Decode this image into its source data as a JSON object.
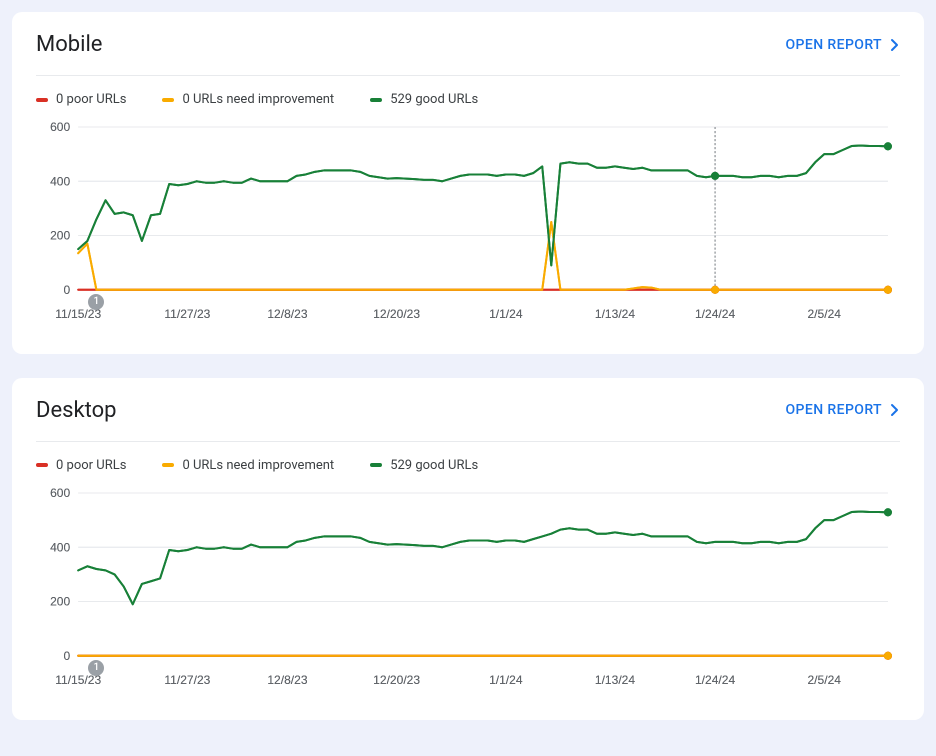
{
  "open_report_label": "OPEN REPORT",
  "event_marker_label": "1",
  "colors": {
    "poor": "#d93025",
    "needs": "#f9ab00",
    "good": "#188038",
    "grid": "#e8eaed",
    "axis_text": "#5f6368",
    "hover_line": "#80868b"
  },
  "mobile": {
    "title": "Mobile",
    "legend": {
      "poor": "0 poor URLs",
      "needs": "0 URLs need improvement",
      "good": "529 good URLs"
    },
    "hover_date_idx": 70
  },
  "desktop": {
    "title": "Desktop",
    "legend": {
      "poor": "0 poor URLs",
      "needs": "0 URLs need improvement",
      "good": "529 good URLs"
    }
  },
  "chart_data": [
    {
      "id": "mobile",
      "type": "line",
      "title": "Mobile",
      "xlabel": "",
      "ylabel": "",
      "ylim": [
        0,
        600
      ],
      "y_ticks": [
        0,
        200,
        400,
        600
      ],
      "x_tick_labels": [
        "11/15/23",
        "11/27/23",
        "12/8/23",
        "12/20/23",
        "1/1/24",
        "1/13/24",
        "1/24/24",
        "2/5/24"
      ],
      "x_tick_idx": [
        0,
        12,
        23,
        35,
        47,
        59,
        70,
        82
      ],
      "n_points": 90,
      "event_marker_idx": 2,
      "hover_idx": 70,
      "series": [
        {
          "name": "0 poor URLs",
          "color": "#d93025",
          "values": [
            0,
            0,
            0,
            0,
            0,
            0,
            0,
            0,
            0,
            0,
            0,
            0,
            0,
            0,
            0,
            0,
            0,
            0,
            0,
            0,
            0,
            0,
            0,
            0,
            0,
            0,
            0,
            0,
            0,
            0,
            0,
            0,
            0,
            0,
            0,
            0,
            0,
            0,
            0,
            0,
            0,
            0,
            0,
            0,
            0,
            0,
            0,
            0,
            0,
            0,
            0,
            0,
            0,
            0,
            0,
            0,
            0,
            0,
            0,
            0,
            0,
            0,
            0,
            0,
            0,
            0,
            0,
            0,
            0,
            0,
            0,
            0,
            0,
            0,
            0,
            0,
            0,
            0,
            0,
            0,
            0,
            0,
            0,
            0,
            0,
            0,
            0,
            0,
            0,
            0
          ]
        },
        {
          "name": "0 URLs need improvement",
          "color": "#f9ab00",
          "values": [
            135,
            170,
            0,
            0,
            0,
            0,
            0,
            0,
            0,
            0,
            0,
            0,
            0,
            0,
            0,
            0,
            0,
            0,
            0,
            0,
            0,
            0,
            0,
            0,
            0,
            0,
            0,
            0,
            0,
            0,
            0,
            0,
            0,
            0,
            0,
            0,
            0,
            0,
            0,
            0,
            0,
            0,
            0,
            0,
            0,
            0,
            0,
            0,
            0,
            0,
            0,
            0,
            250,
            0,
            0,
            0,
            0,
            0,
            0,
            0,
            0,
            5,
            10,
            8,
            0,
            0,
            0,
            0,
            0,
            0,
            0,
            0,
            0,
            0,
            0,
            0,
            0,
            0,
            0,
            0,
            0,
            0,
            0,
            0,
            0,
            0,
            0,
            0,
            0,
            0
          ]
        },
        {
          "name": "529 good URLs",
          "color": "#188038",
          "values": [
            150,
            180,
            260,
            330,
            280,
            285,
            275,
            180,
            275,
            280,
            390,
            385,
            390,
            400,
            395,
            395,
            400,
            395,
            395,
            410,
            400,
            400,
            400,
            400,
            420,
            425,
            435,
            440,
            440,
            440,
            440,
            435,
            420,
            415,
            410,
            412,
            410,
            408,
            405,
            405,
            400,
            410,
            420,
            425,
            425,
            425,
            420,
            425,
            425,
            420,
            430,
            455,
            90,
            465,
            470,
            465,
            465,
            450,
            450,
            455,
            450,
            445,
            450,
            440,
            440,
            440,
            440,
            440,
            420,
            415,
            420,
            420,
            420,
            415,
            415,
            420,
            420,
            415,
            420,
            420,
            430,
            470,
            500,
            500,
            515,
            530,
            532,
            530,
            530,
            529
          ]
        }
      ]
    },
    {
      "id": "desktop",
      "type": "line",
      "title": "Desktop",
      "xlabel": "",
      "ylabel": "",
      "ylim": [
        0,
        600
      ],
      "y_ticks": [
        0,
        200,
        400,
        600
      ],
      "x_tick_labels": [
        "11/15/23",
        "11/27/23",
        "12/8/23",
        "12/20/23",
        "1/1/24",
        "1/13/24",
        "1/24/24",
        "2/5/24"
      ],
      "x_tick_idx": [
        0,
        12,
        23,
        35,
        47,
        59,
        70,
        82
      ],
      "n_points": 90,
      "event_marker_idx": 2,
      "series": [
        {
          "name": "0 poor URLs",
          "color": "#d93025",
          "values": [
            0,
            0,
            0,
            0,
            0,
            0,
            0,
            0,
            0,
            0,
            0,
            0,
            0,
            0,
            0,
            0,
            0,
            0,
            0,
            0,
            0,
            0,
            0,
            0,
            0,
            0,
            0,
            0,
            0,
            0,
            0,
            0,
            0,
            0,
            0,
            0,
            0,
            0,
            0,
            0,
            0,
            0,
            0,
            0,
            0,
            0,
            0,
            0,
            0,
            0,
            0,
            0,
            0,
            0,
            0,
            0,
            0,
            0,
            0,
            0,
            0,
            0,
            0,
            0,
            0,
            0,
            0,
            0,
            0,
            0,
            0,
            0,
            0,
            0,
            0,
            0,
            0,
            0,
            0,
            0,
            0,
            0,
            0,
            0,
            0,
            0,
            0,
            0,
            0,
            0
          ]
        },
        {
          "name": "0 URLs need improvement",
          "color": "#f9ab00",
          "values": [
            0,
            0,
            0,
            0,
            0,
            0,
            0,
            0,
            0,
            0,
            0,
            0,
            0,
            0,
            0,
            0,
            0,
            0,
            0,
            0,
            0,
            0,
            0,
            0,
            0,
            0,
            0,
            0,
            0,
            0,
            0,
            0,
            0,
            0,
            0,
            0,
            0,
            0,
            0,
            0,
            0,
            0,
            0,
            0,
            0,
            0,
            0,
            0,
            0,
            0,
            0,
            0,
            0,
            0,
            0,
            0,
            0,
            0,
            0,
            0,
            0,
            0,
            0,
            0,
            0,
            0,
            0,
            0,
            0,
            0,
            0,
            0,
            0,
            0,
            0,
            0,
            0,
            0,
            0,
            0,
            0,
            0,
            0,
            0,
            0,
            0,
            0,
            0,
            0,
            0
          ]
        },
        {
          "name": "529 good URLs",
          "color": "#188038",
          "values": [
            315,
            330,
            320,
            315,
            300,
            255,
            190,
            265,
            275,
            285,
            390,
            385,
            390,
            400,
            395,
            395,
            400,
            395,
            395,
            410,
            400,
            400,
            400,
            400,
            420,
            425,
            435,
            440,
            440,
            440,
            440,
            435,
            420,
            415,
            410,
            412,
            410,
            408,
            405,
            405,
            400,
            410,
            420,
            425,
            425,
            425,
            420,
            425,
            425,
            420,
            430,
            440,
            450,
            465,
            470,
            465,
            465,
            450,
            450,
            455,
            450,
            445,
            450,
            440,
            440,
            440,
            440,
            440,
            420,
            415,
            420,
            420,
            420,
            415,
            415,
            420,
            420,
            415,
            420,
            420,
            430,
            470,
            500,
            500,
            515,
            530,
            532,
            530,
            530,
            529
          ]
        }
      ]
    }
  ]
}
